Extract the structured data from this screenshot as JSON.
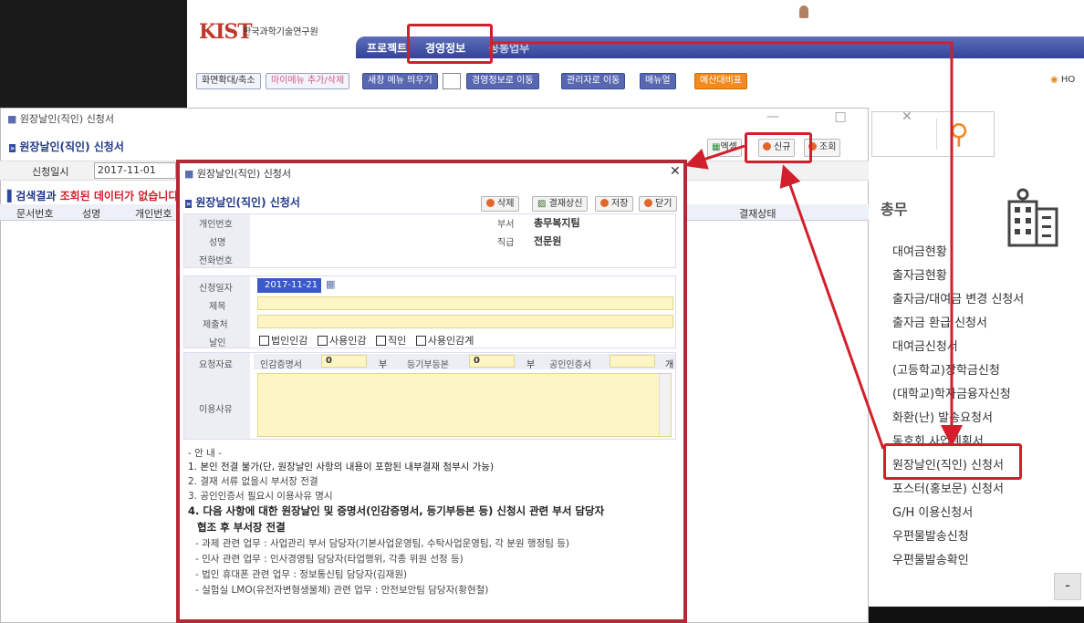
{
  "header": {
    "logo_mark": "KIST",
    "institute": "한국과학기술연구원",
    "nav_tabs": [
      "프로젝트",
      "경영정보",
      "공통업무"
    ],
    "toolbar": [
      "화면확대/축소",
      "마이메뉴 추가/삭제",
      "새창 메뉴 띄우기",
      "경영정보로 이동",
      "관리자로 이동",
      "매뉴얼",
      "예산대비표"
    ],
    "home_label": "HO"
  },
  "right_panel": {
    "title": "총무",
    "items": [
      "대여금현황",
      "출자금현황",
      "출자금/대여금 변경 신청서",
      "출자금 환급 신청서",
      "대여금신청서",
      "(고등학교)장학금신청",
      "(대학교)학자금융자신청",
      "화환(난) 발송요청서",
      "동호회 사업계획서",
      "원장날인(직인) 신청서",
      "포스터(홍보문) 신청서",
      "G/H 이용신청서",
      "우편물발송신청",
      "우편물발송확인"
    ],
    "scroll_btn": "-"
  },
  "outer_window": {
    "title": "원장날인(직인) 신청서",
    "heading": "원장날인(직인) 신청서",
    "date_label": "신청일시",
    "date_value": "2017-11-01",
    "result_label": "검색결과",
    "result_msg": "조회된 데이터가 없습니다",
    "columns": [
      "문서번호",
      "성명",
      "개인번호",
      "결재상태"
    ],
    "buttons": [
      "엑셀",
      "신규",
      "조회"
    ]
  },
  "modal": {
    "title": "원장날인(직인) 신청서",
    "heading": "원장날인(직인) 신청서",
    "buttons": [
      "삭제",
      "결재상신",
      "저장",
      "닫기"
    ],
    "labels": {
      "emp_no": "개인번호",
      "name": "성명",
      "phone": "전화번호",
      "dept": "부서",
      "position": "직급",
      "date": "신청일자",
      "subject": "제목",
      "submit_to": "제출처",
      "seal": "날인",
      "docs": "요청자료",
      "reason": "이용사유"
    },
    "values": {
      "dept": "총무복지팀",
      "position": "전문원",
      "date": "2017-11-21"
    },
    "seal_options": [
      "법인인감",
      "사용인감",
      "직인",
      "사용인감계"
    ],
    "docs": {
      "cert_label": "인감증명서",
      "cert_count": "0",
      "unit1": "부",
      "reg_label": "등기부등본",
      "reg_count": "0",
      "unit2": "부",
      "pub_label": "공인인증서",
      "unit3": "개"
    },
    "guide": [
      "- 안 내 -",
      "1. 본인 전결 불가(단, 원장날인 사항의 내용이 포함된 내부결재 첨부시 가능)",
      "2. 결재 서류 없을시 부서장 전결",
      "3. 공인인증서 필요시 이용사유 명시",
      "4. 다음 사항에 대한 원장날인 및 증명서(인감증명서, 등기부등본 등) 신청시 관련 부서 담당자",
      "협조 후 부서장 전결",
      "- 과제 관련 업무 : 사업관리 부서 담당자(기본사업운영팀, 수탁사업운영팀, 각 분원 행정팀 등)",
      "- 인사 관련 업무 : 인사경영팀 담당자(타업행위, 각종 위원 선정 등)",
      "- 법인 휴대폰 관련 업무 : 정보통신팀 담당자(김재원)",
      "- 실험실 LMO(유전자변형생물체) 관련 업무 : 안전보안팀 담당자(황현철)"
    ]
  },
  "colors": {
    "accent_red": "#d21f2b",
    "nav_blue": "#3b4b9a",
    "search_orange": "#f08a24"
  }
}
